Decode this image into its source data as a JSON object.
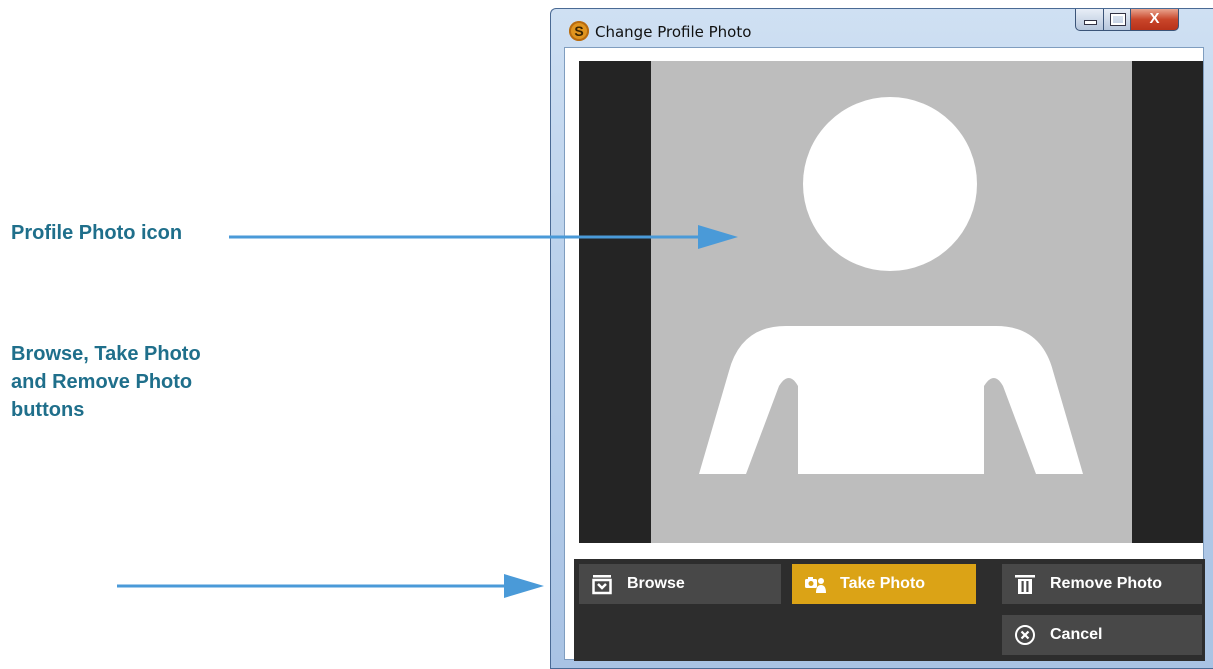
{
  "callouts": {
    "profile_photo": "Profile Photo icon",
    "buttons_lines": [
      "Browse, Take Photo",
      "and Remove Photo",
      "buttons"
    ]
  },
  "window": {
    "title": "Change Profile Photo",
    "app_icon": "S",
    "close_glyph": "X"
  },
  "buttons": {
    "browse": "Browse",
    "take_photo": "Take Photo",
    "remove_photo": "Remove Photo",
    "cancel": "Cancel"
  },
  "colors": {
    "annotation": "#1f6f8b",
    "arrow": "#4a9ad8",
    "active_button": "#dba316",
    "button": "#484848",
    "photo_background": "#bdbdbd"
  },
  "icons": {
    "browse": "folder-download-icon",
    "take_photo": "camera-person-icon",
    "remove_photo": "trash-icon",
    "cancel": "circle-x-icon"
  }
}
